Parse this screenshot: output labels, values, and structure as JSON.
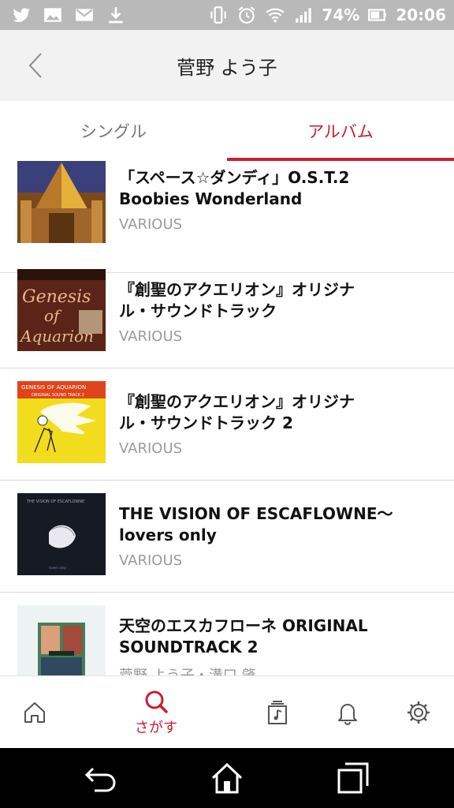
{
  "status_bar": {
    "battery_percent": "74%",
    "time": "20:06",
    "left_icons": [
      "twitter-icon",
      "image-icon",
      "mail-icon",
      "download-icon"
    ],
    "right_icons": [
      "vibrate-icon",
      "alarm-icon",
      "wifi-icon",
      "signal-icon",
      "battery-icon"
    ]
  },
  "header": {
    "title": "菅野 よう子"
  },
  "tabs": [
    {
      "label": "シングル",
      "active": false
    },
    {
      "label": "アルバム",
      "active": true
    }
  ],
  "albums": [
    {
      "title_line1": "「スペース☆ダンディ」O.S.T.2",
      "title_line2": "Boobies Wonderland",
      "artist": "VARIOUS"
    },
    {
      "title_line1": "『創聖のアクエリオン』オリジナ",
      "title_line2": "ル・サウンドトラック",
      "artist": "VARIOUS"
    },
    {
      "title_line1": "『創聖のアクエリオン』オリジナ",
      "title_line2": "ル・サウンドトラック 2",
      "artist": "VARIOUS"
    },
    {
      "title_line1": "THE VISION OF ESCAFLOWNE～",
      "title_line2": "lovers only",
      "artist": "VARIOUS"
    },
    {
      "title_line1": "天空のエスカフローネ ORIGINAL",
      "title_line2": "SOUNDTRACK 2",
      "artist": "菅野 よう子・溝口 肇"
    }
  ],
  "bottom_nav": {
    "items": [
      {
        "icon": "home-icon",
        "label": ""
      },
      {
        "icon": "search-icon",
        "label": "さがす",
        "active": true
      },
      {
        "icon": "library-icon",
        "label": ""
      },
      {
        "icon": "bell-icon",
        "label": ""
      },
      {
        "icon": "gear-icon",
        "label": ""
      }
    ]
  },
  "colors": {
    "accent": "#c8202d",
    "header_bg": "#f2f2f2",
    "status_bar_bg": "#b9b9b9"
  }
}
